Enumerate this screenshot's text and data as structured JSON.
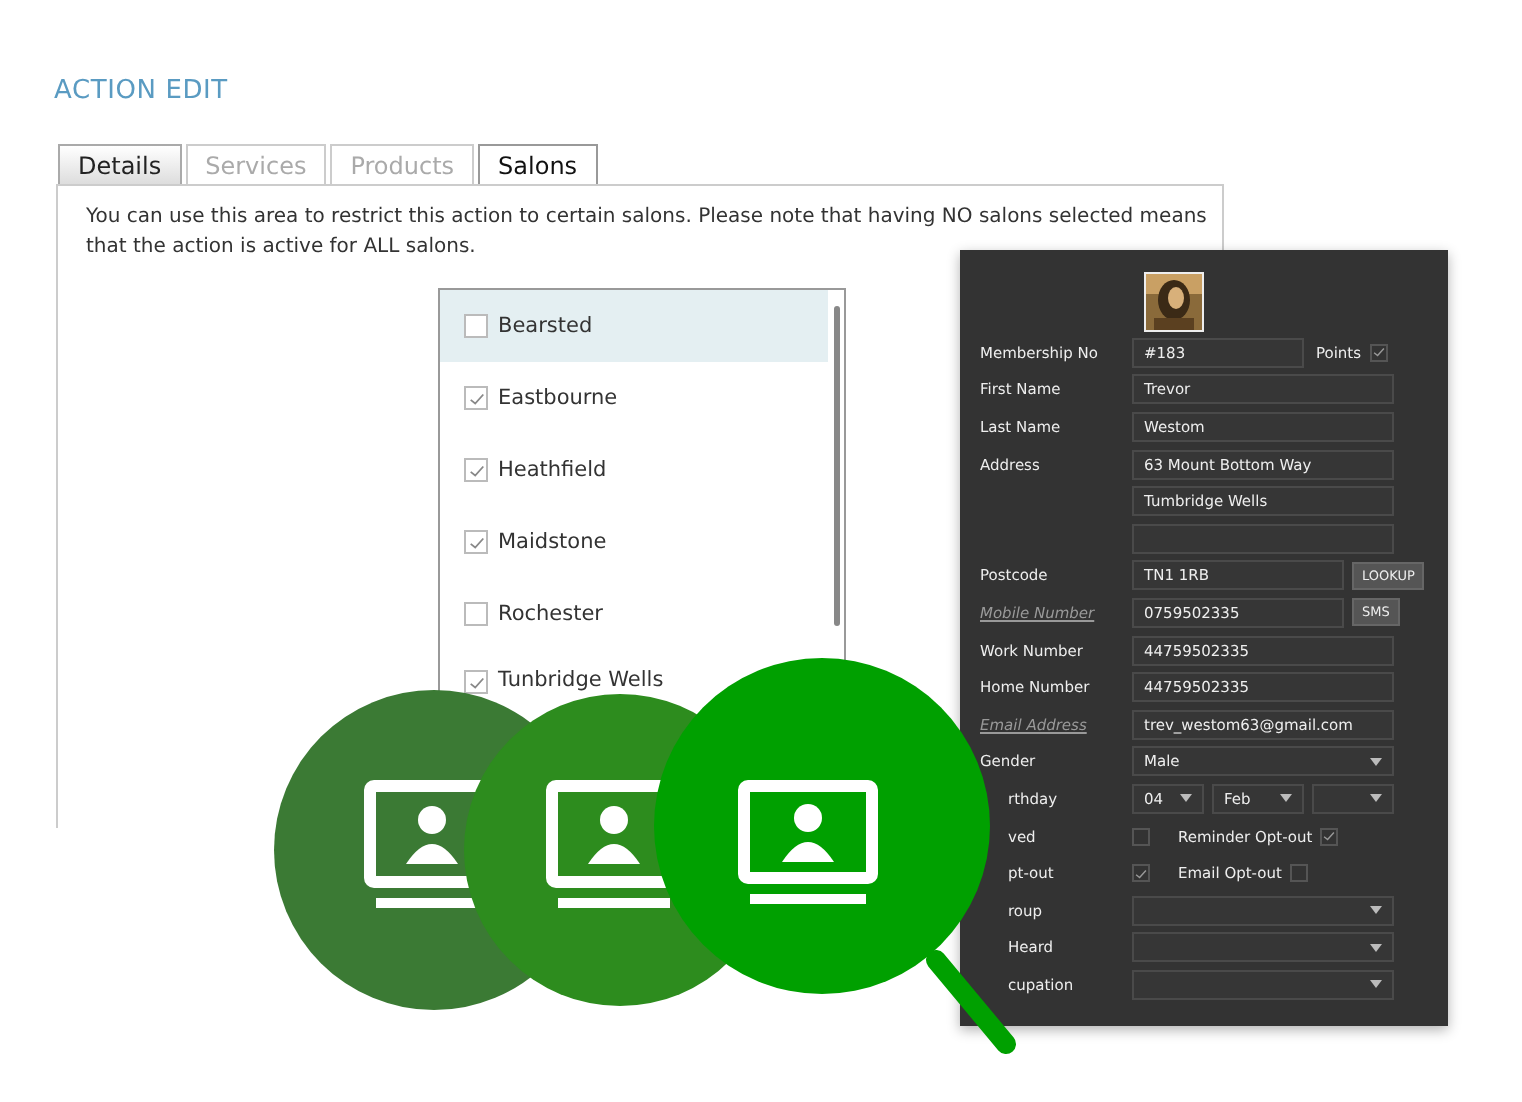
{
  "page": {
    "title": "ACTION EDIT"
  },
  "tabs": [
    {
      "label": "Details",
      "selected": false,
      "disabled": false
    },
    {
      "label": "Services",
      "selected": false,
      "disabled": true
    },
    {
      "label": "Products",
      "selected": false,
      "disabled": true
    },
    {
      "label": "Salons",
      "selected": true,
      "disabled": false
    }
  ],
  "description": "You can use this area to restrict this action to certain salons. Please note that having NO salons selected means that the action is active for ALL salons.",
  "salons": [
    {
      "name": "Bearsted",
      "checked": false,
      "highlighted": true
    },
    {
      "name": "Eastbourne",
      "checked": true,
      "highlighted": false
    },
    {
      "name": "Heathfield",
      "checked": true,
      "highlighted": false
    },
    {
      "name": "Maidstone",
      "checked": true,
      "highlighted": false
    },
    {
      "name": "Rochester",
      "checked": false,
      "highlighted": false
    },
    {
      "name": "Tunbridge Wells",
      "checked": true,
      "highlighted": false
    }
  ],
  "customer_form": {
    "fields": [
      {
        "kind": "text",
        "label": "Membership No",
        "value": "#183",
        "side": {
          "label": "Points",
          "checked": true
        }
      },
      {
        "kind": "text",
        "label": "First Name",
        "value": "Trevor"
      },
      {
        "kind": "text",
        "label": "Last Name",
        "value": "Westom"
      },
      {
        "kind": "text",
        "label": "Address",
        "value": "63 Mount Bottom Way"
      },
      {
        "kind": "text",
        "value": "Tumbridge Wells"
      },
      {
        "kind": "text"
      },
      {
        "kind": "text",
        "label": "Postcode",
        "value": "TN1 1RB",
        "button": "LOOKUP"
      },
      {
        "kind": "text",
        "label": "Mobile Number",
        "link": true,
        "value": "0759502335",
        "button": "SMS"
      },
      {
        "kind": "text",
        "label": "Work Number",
        "value": "44759502335"
      },
      {
        "kind": "text",
        "label": "Home Number",
        "value": "44759502335"
      },
      {
        "kind": "text",
        "label": "Email Address",
        "link": true,
        "value": "trev_westom63@gmail.com"
      },
      {
        "kind": "select",
        "label": "Gender",
        "value": "Male"
      },
      {
        "kind": "date",
        "label": "rthday",
        "cut": true,
        "parts": [
          {
            "kind": "select",
            "value": "04"
          },
          {
            "kind": "select",
            "value": "Feb"
          },
          {
            "kind": "select"
          }
        ]
      },
      {
        "kind": "checks",
        "label": "ved",
        "cut": true,
        "checked": false,
        "extra": {
          "label": "Reminder Opt-out",
          "checked": true
        }
      },
      {
        "kind": "checks",
        "label": "pt-out",
        "cut": true,
        "checked": true,
        "extra": {
          "label": "Email Opt-out",
          "checked": false
        }
      },
      {
        "kind": "select",
        "label": "roup",
        "cut": true
      },
      {
        "kind": "select",
        "label": "Heard",
        "cut": true
      },
      {
        "kind": "select",
        "label": "cupation",
        "cut": true
      }
    ]
  }
}
